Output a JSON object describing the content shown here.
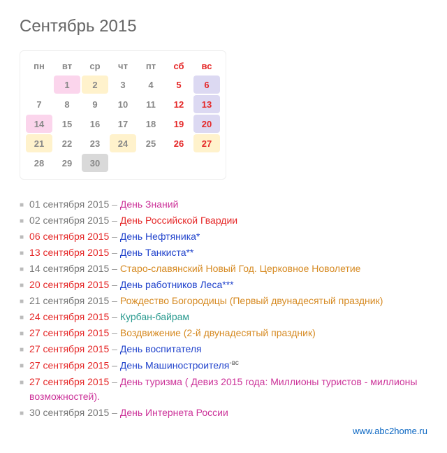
{
  "title": "Сентябрь 2015",
  "weekdays": [
    "пн",
    "вт",
    "ср",
    "чт",
    "пт",
    "сб",
    "вс"
  ],
  "calendar": [
    [
      {
        "d": ""
      },
      {
        "d": "1",
        "hl": "hl-pink"
      },
      {
        "d": "2",
        "hl": "hl-yellow"
      },
      {
        "d": "3"
      },
      {
        "d": "4"
      },
      {
        "d": "5",
        "cls": "sat"
      },
      {
        "d": "6",
        "cls": "sun",
        "hl": "hl-lav"
      }
    ],
    [
      {
        "d": "7"
      },
      {
        "d": "8"
      },
      {
        "d": "9"
      },
      {
        "d": "10"
      },
      {
        "d": "11"
      },
      {
        "d": "12",
        "cls": "sat"
      },
      {
        "d": "13",
        "cls": "sun",
        "hl": "hl-lav"
      }
    ],
    [
      {
        "d": "14",
        "hl": "hl-pink"
      },
      {
        "d": "15"
      },
      {
        "d": "16"
      },
      {
        "d": "17"
      },
      {
        "d": "18"
      },
      {
        "d": "19",
        "cls": "sat"
      },
      {
        "d": "20",
        "cls": "sun",
        "hl": "hl-lav"
      }
    ],
    [
      {
        "d": "21",
        "hl": "hl-yellow"
      },
      {
        "d": "22"
      },
      {
        "d": "23"
      },
      {
        "d": "24",
        "hl": "hl-yellow"
      },
      {
        "d": "25"
      },
      {
        "d": "26",
        "cls": "sat"
      },
      {
        "d": "27",
        "cls": "sun",
        "hl": "hl-yellow"
      }
    ],
    [
      {
        "d": "28"
      },
      {
        "d": "29"
      },
      {
        "d": "30",
        "hl": "hl-today"
      },
      {
        "d": ""
      },
      {
        "d": ""
      },
      {
        "d": ""
      },
      {
        "d": ""
      }
    ]
  ],
  "events": [
    {
      "date": "01 сентября 2015",
      "dateCls": "date-norm",
      "title": "День Знаний",
      "titleCls": "t-magenta"
    },
    {
      "date": "02 сентября 2015",
      "dateCls": "date-norm",
      "title": "День Российской Гвардии",
      "titleCls": "t-red"
    },
    {
      "date": "06 сентября 2015",
      "dateCls": "date-red",
      "title": "День Нефтяника*",
      "titleCls": "t-blue"
    },
    {
      "date": "13 сентября 2015",
      "dateCls": "date-red",
      "title": "День Танкиста**",
      "titleCls": "t-blue"
    },
    {
      "date": "14 сентября 2015",
      "dateCls": "date-norm",
      "title": "Старо-славянский Новый Год. Церковное Новолетие",
      "titleCls": "t-orange"
    },
    {
      "date": "20 сентября 2015",
      "dateCls": "date-red",
      "title": "День работников Леса***",
      "titleCls": "t-blue"
    },
    {
      "date": "21 сентября 2015",
      "dateCls": "date-norm",
      "title": "Рождество Богородицы (Первый двунадесятый праздник)",
      "titleCls": "t-orange"
    },
    {
      "date": "24 сентября 2015",
      "dateCls": "date-red",
      "title": "Курбан-байрам",
      "titleCls": "t-teal"
    },
    {
      "date": "27 сентября 2015",
      "dateCls": "date-red",
      "title": "Воздвижение (2-й двунадесятый праздник)",
      "titleCls": "t-orange"
    },
    {
      "date": "27 сентября 2015",
      "dateCls": "date-red",
      "title": "День воспитателя",
      "titleCls": "t-blue"
    },
    {
      "date": "27 сентября 2015",
      "dateCls": "date-red",
      "title": "День Машиностроителя",
      "titleCls": "t-blue",
      "sup": "-вс"
    },
    {
      "date": "27 сентября 2015",
      "dateCls": "date-red",
      "title": "День туризма ( Девиз 2015 года: Миллионы туристов - миллионы возможностей).",
      "titleCls": "t-magenta"
    },
    {
      "date": "30 сентября 2015",
      "dateCls": "date-norm",
      "title": "День Интернета России",
      "titleCls": "t-magenta"
    }
  ],
  "footer": {
    "link_text": "www.abc2home.ru",
    "link_href": "#"
  }
}
